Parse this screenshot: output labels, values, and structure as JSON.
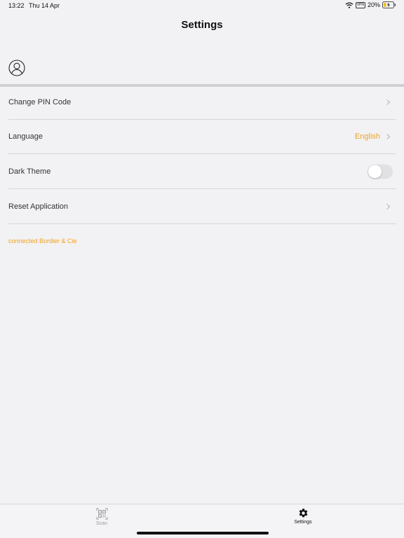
{
  "status_bar": {
    "time": "13:22",
    "date": "Thu 14 Apr",
    "vpn": "VPN",
    "battery": "20%"
  },
  "header": {
    "title": "Settings"
  },
  "settings": {
    "items": [
      {
        "label": "Change PIN Code",
        "value": ""
      },
      {
        "label": "Language",
        "value": "English"
      },
      {
        "label": "Dark Theme",
        "toggle": false
      },
      {
        "label": "Reset Application",
        "value": ""
      }
    ],
    "connection_status": "connected Bordier & Cie"
  },
  "tab_bar": {
    "tabs": [
      {
        "label": "Scan",
        "icon": "qr-code-icon",
        "active": false
      },
      {
        "label": "Settings",
        "icon": "gear-icon",
        "active": true
      }
    ]
  },
  "colors": {
    "accent": "#f0a21c",
    "background": "#f2f2f4",
    "divider": "#d6d6d9"
  }
}
